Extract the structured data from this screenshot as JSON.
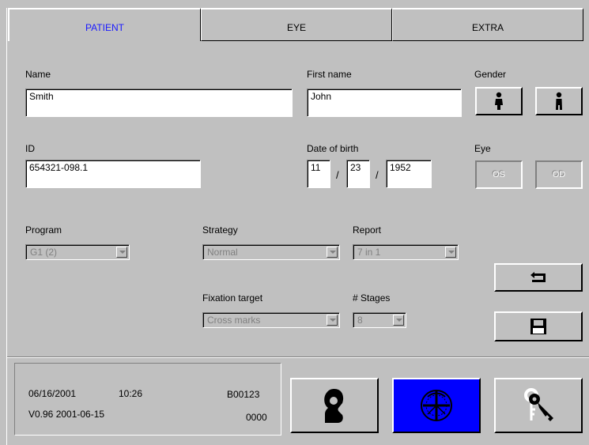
{
  "tabs": [
    {
      "label": "PATIENT",
      "active": true
    },
    {
      "label": "EYE",
      "active": false
    },
    {
      "label": "EXTRA",
      "active": false
    }
  ],
  "patient": {
    "name_label": "Name",
    "name_value": "Smith",
    "first_name_label": "First name",
    "first_name_value": "John",
    "gender_label": "Gender",
    "id_label": "ID",
    "id_value": "654321-098.1",
    "dob_label": "Date of birth",
    "dob_month": "11",
    "dob_day": "23",
    "dob_year": "1952",
    "dob_separator": "/",
    "eye_label": "Eye",
    "eye_os": "OS",
    "eye_od": "OD"
  },
  "settings": {
    "program_label": "Program",
    "program_value": "G1 (2)",
    "strategy_label": "Strategy",
    "strategy_value": "Normal",
    "report_label": "Report",
    "report_value": "7 in 1",
    "fixation_label": "Fixation target",
    "fixation_value": "Cross marks",
    "stages_label": "# Stages",
    "stages_value": "8"
  },
  "status": {
    "date": "06/16/2001",
    "time": "10:26",
    "code": "B00123",
    "version": "V0.96  2001-06-15",
    "count": "0000"
  },
  "icons": {
    "back": "return-arrow-icon",
    "save": "floppy-disk-icon",
    "gender_male": "male-person-icon",
    "gender_female": "female-person-icon",
    "patient": "patient-head-icon",
    "perimetry": "eye-globe-icon",
    "keys": "keys-icon"
  },
  "colors": {
    "active_tab_text": "#1a1aff",
    "perimetry_button_bg": "#0000ff"
  }
}
